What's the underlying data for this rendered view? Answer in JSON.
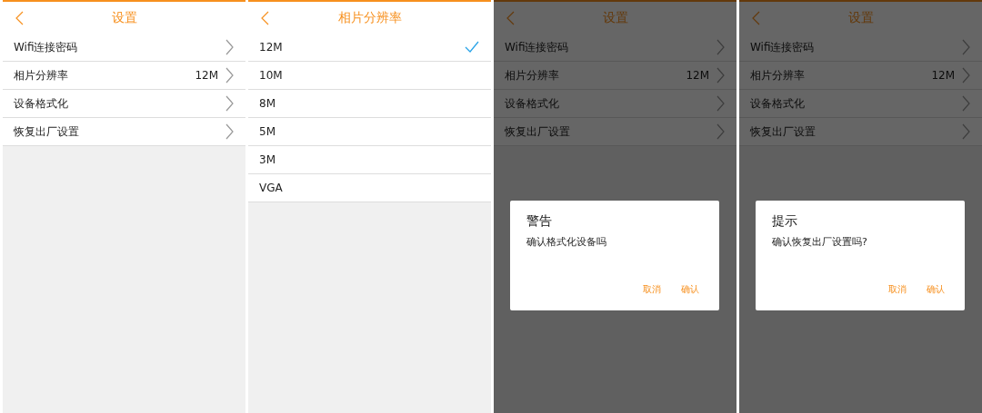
{
  "screens": [
    {
      "kind": "settings",
      "title": "设置",
      "rows": [
        {
          "label": "Wifi连接密码"
        },
        {
          "label": "相片分辨率",
          "value": "12M"
        },
        {
          "label": "设备格式化"
        },
        {
          "label": "恢复出厂设置"
        }
      ]
    },
    {
      "kind": "options",
      "title": "相片分辨率",
      "options": [
        {
          "label": "12M",
          "selected": true
        },
        {
          "label": "10M",
          "selected": false
        },
        {
          "label": "8M",
          "selected": false
        },
        {
          "label": "5M",
          "selected": false
        },
        {
          "label": "3M",
          "selected": false
        },
        {
          "label": "VGA",
          "selected": false
        }
      ]
    },
    {
      "kind": "settings",
      "title": "设置",
      "rows": [
        {
          "label": "Wifi连接密码"
        },
        {
          "label": "相片分辨率",
          "value": "12M"
        },
        {
          "label": "设备格式化"
        },
        {
          "label": "恢复出厂设置"
        }
      ],
      "dialog": {
        "title": "警告",
        "message": "确认格式化设备吗",
        "buttons": [
          "取消",
          "确认"
        ]
      }
    },
    {
      "kind": "settings",
      "title": "设置",
      "rows": [
        {
          "label": "Wifi连接密码"
        },
        {
          "label": "相片分辨率",
          "value": "12M"
        },
        {
          "label": "设备格式化"
        },
        {
          "label": "恢复出厂设置"
        }
      ],
      "dialog": {
        "title": "提示",
        "message": "确认恢复出厂设置吗?",
        "buttons": [
          "取消",
          "确认"
        ]
      }
    }
  ]
}
